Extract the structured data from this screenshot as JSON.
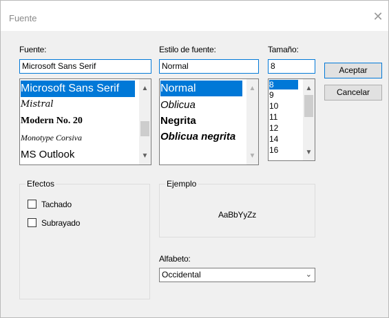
{
  "window": {
    "title": "Fuente",
    "close_glyph": "✕"
  },
  "font": {
    "label": "Fuente:",
    "value": "Microsoft Sans Serif",
    "items": [
      {
        "label": "Microsoft Sans Serif",
        "selected": true
      },
      {
        "label": "Mistral"
      },
      {
        "label": "Modern No. 20"
      },
      {
        "label": "Monotype Corsiva"
      },
      {
        "label": "MS Outlook"
      }
    ]
  },
  "style": {
    "label": "Estilo de fuente:",
    "value": "Normal",
    "items": [
      {
        "label": "Normal",
        "selected": true
      },
      {
        "label": "Oblicua"
      },
      {
        "label": "Negrita"
      },
      {
        "label": "Oblicua negrita"
      }
    ]
  },
  "size": {
    "label": "Tamaño:",
    "value": "8",
    "items": [
      {
        "label": "8",
        "selected": true
      },
      {
        "label": "9"
      },
      {
        "label": "10"
      },
      {
        "label": "11"
      },
      {
        "label": "12"
      },
      {
        "label": "14"
      },
      {
        "label": "16"
      }
    ]
  },
  "buttons": {
    "accept": "Aceptar",
    "cancel": "Cancelar"
  },
  "effects": {
    "title": "Efectos",
    "strikeout": "Tachado",
    "underline": "Subrayado"
  },
  "sample": {
    "title": "Ejemplo",
    "text": "AaBbYyZz"
  },
  "script": {
    "label": "Alfabeto:",
    "value": "Occidental"
  },
  "icons": {
    "up": "up-arrow-icon",
    "down": "down-arrow-icon",
    "chevron": "chevron-down-icon",
    "close": "close-icon"
  },
  "colors": {
    "accent": "#0078d7",
    "dialog_bg": "#f0f0f0"
  }
}
